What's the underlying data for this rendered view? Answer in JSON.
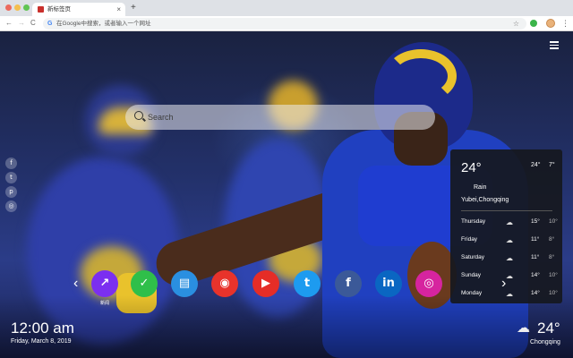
{
  "browser": {
    "tab_title": "新标签页",
    "tab_close": "×",
    "new_tab": "+",
    "omnibox_placeholder": "在Google中搜索，或者输入一个网址",
    "back": "←",
    "forward": "→",
    "reload": "C",
    "star": "☆",
    "menu": "⋮",
    "google_g": "G"
  },
  "search": {
    "placeholder": "Search"
  },
  "side_social": [
    {
      "icon": "facebook-icon",
      "glyph": "f"
    },
    {
      "icon": "twitter-icon",
      "glyph": "t"
    },
    {
      "icon": "pinterest-icon",
      "glyph": "p"
    },
    {
      "icon": "instagram-icon",
      "glyph": "◎"
    }
  ],
  "weather_panel": {
    "current_temp": "24°",
    "high": "24°",
    "low": "7°",
    "condition": "Rain",
    "location": "Yubei,Chongqing",
    "forecast": [
      {
        "day": "Thursday",
        "high": "15°",
        "low": "10°"
      },
      {
        "day": "Friday",
        "high": "11°",
        "low": "8°"
      },
      {
        "day": "Saturday",
        "high": "11°",
        "low": "8°"
      },
      {
        "day": "Sunday",
        "high": "14°",
        "low": "10°"
      },
      {
        "day": "Monday",
        "high": "14°",
        "low": "10°"
      }
    ]
  },
  "shortcuts": {
    "prev": "‹",
    "next": "›",
    "items": [
      {
        "name": "trend-app",
        "color": "#7b2ff0",
        "glyph": "↗",
        "label": "新闻"
      },
      {
        "name": "check-app",
        "color": "#2fbf4a",
        "glyph": "✓",
        "label": ""
      },
      {
        "name": "news-app",
        "color": "#2a8fe0",
        "glyph": "▤",
        "label": ""
      },
      {
        "name": "game-app",
        "color": "#e8332b",
        "glyph": "◉",
        "label": ""
      },
      {
        "name": "youtube",
        "color": "#e52d27",
        "glyph": "▶",
        "label": ""
      },
      {
        "name": "twitter",
        "color": "#1d9bf0",
        "glyph": "t",
        "label": ""
      },
      {
        "name": "facebook",
        "color": "#3b5998",
        "glyph": "f",
        "label": ""
      },
      {
        "name": "linkedin",
        "color": "#0a66c2",
        "glyph": "in",
        "label": ""
      },
      {
        "name": "instagram",
        "color": "#d6249f",
        "glyph": "◎",
        "label": ""
      }
    ]
  },
  "clock": {
    "time": "12:00 am",
    "date": "Friday, March 8, 2019"
  },
  "mini_weather": {
    "temp": "24°",
    "city": "Chongqing"
  },
  "colors": {
    "weather_bg": "#16181e",
    "search_bg": "#ebebf0"
  }
}
